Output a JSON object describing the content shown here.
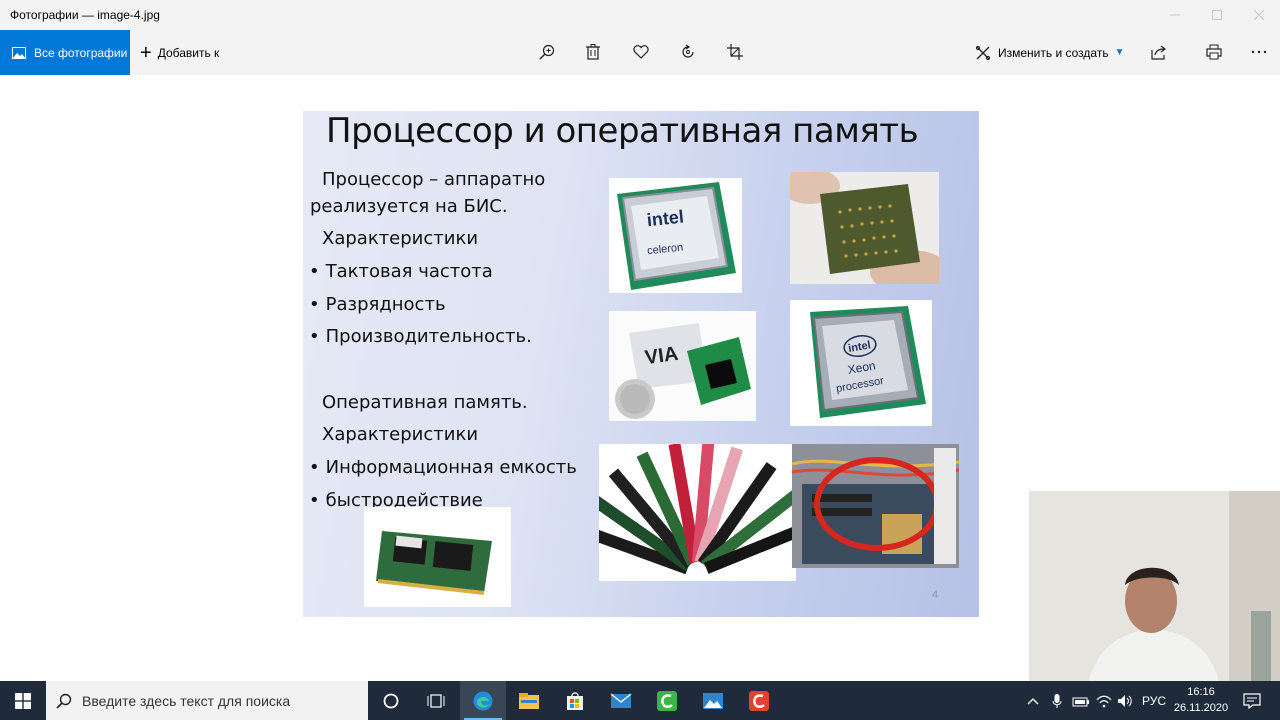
{
  "window": {
    "title": "Фотографии — image-4.jpg"
  },
  "toolbar": {
    "all_photos_label": "Все фотографии",
    "add_to_label": "Добавить к",
    "edit_create_label": "Изменить и создать",
    "icons": [
      "zoom-icon",
      "delete-icon",
      "favorite-icon",
      "rotate-icon",
      "crop-icon",
      "share-icon",
      "print-icon",
      "more-icon"
    ]
  },
  "slide": {
    "title": "Процессор и оперативная память",
    "lines": [
      "Процессор – аппаратно",
      "реализуется на БИС.",
      "Характеристики",
      "Тактовая частота",
      "Разрядность",
      "Производительность.",
      "Оперативная память.",
      "Характеристики",
      "Информационная емкость",
      "быстродействие"
    ],
    "page_number": "4",
    "chip_labels": {
      "intel": "intel",
      "celeron": "celeron",
      "intel2": "intel",
      "xeon": "Xeon",
      "processor": "processor"
    }
  },
  "taskbar": {
    "search_placeholder": "Введите здесь текст для поиска",
    "language": "РУС",
    "time": "16:16",
    "date": "26.11.2020"
  },
  "colors": {
    "accent": "#0078d7",
    "taskbar": "#1f2a3b"
  }
}
